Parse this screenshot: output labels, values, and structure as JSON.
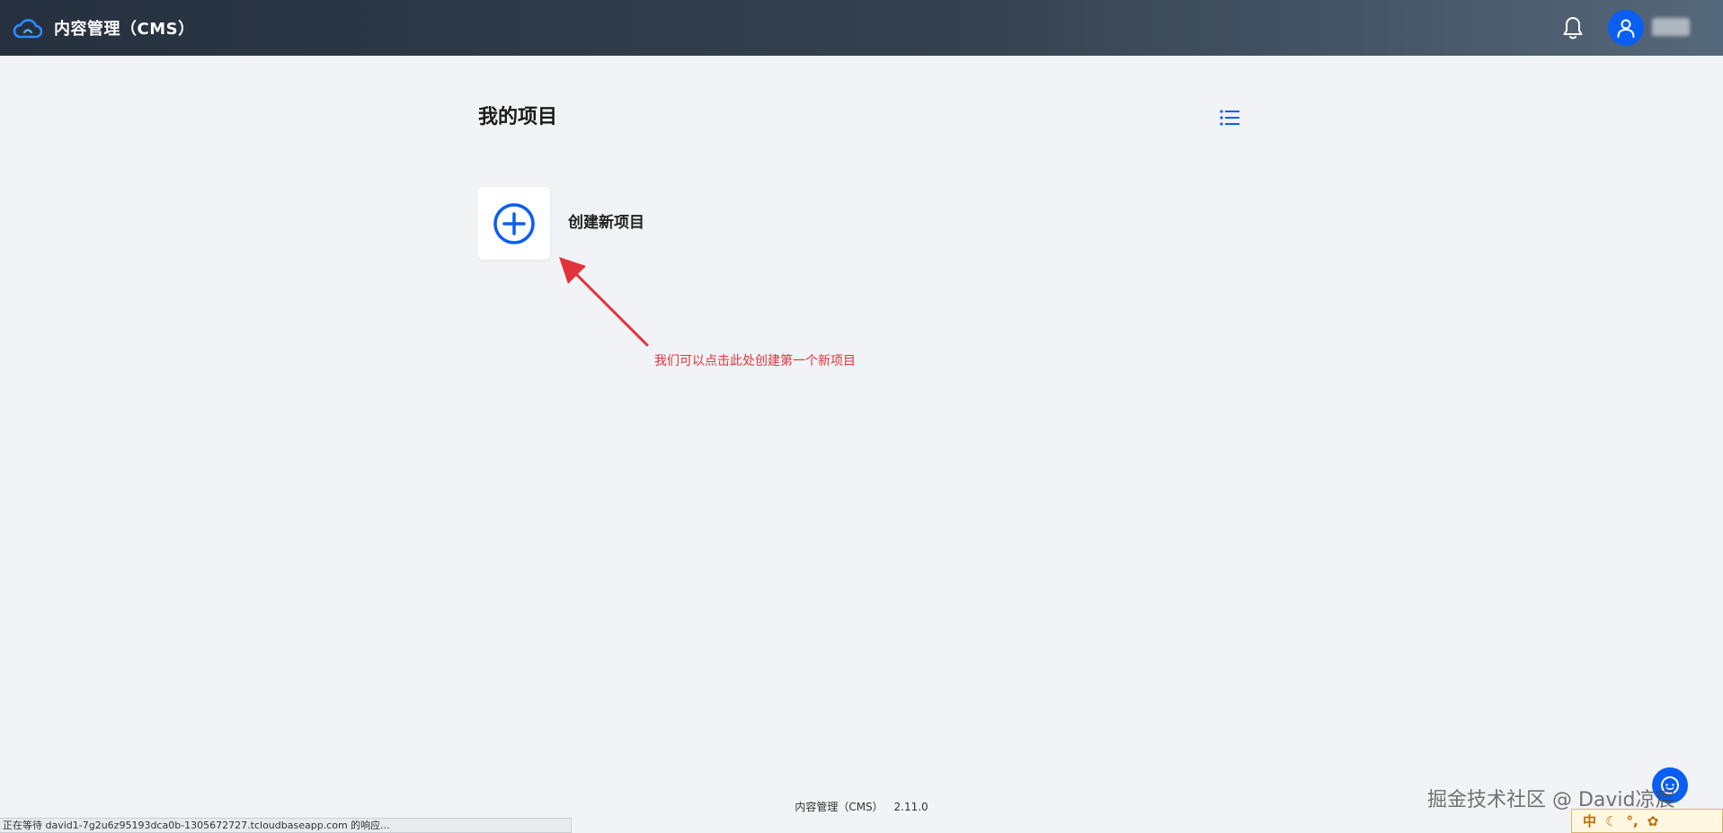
{
  "header": {
    "app_title": "内容管理（CMS）",
    "colors": {
      "accent": "#0a5ff2",
      "topbar": "#2e3a48"
    }
  },
  "main": {
    "page_title": "我的项目",
    "create_project": {
      "label": "创建新项目"
    },
    "annotation": "我们可以点击此处创建第一个新项目",
    "annotation_color": "#e0343b"
  },
  "footer": {
    "name": "内容管理（CMS）",
    "version": "2.11.0"
  },
  "status_bar": {
    "text": "正在等待 david1-7g2u6z95193dca0b-1305672727.tcloudbaseapp.com 的响应..."
  },
  "overlay": {
    "watermark": "掘金技术社区 @ David凉宸",
    "ime_label": "中"
  },
  "icons": {
    "logo": "cloud-logo-icon",
    "bell": "bell-icon",
    "avatar": "user-icon",
    "list": "list-view-icon",
    "create": "plus-circle-icon",
    "help": "chat-icon"
  }
}
